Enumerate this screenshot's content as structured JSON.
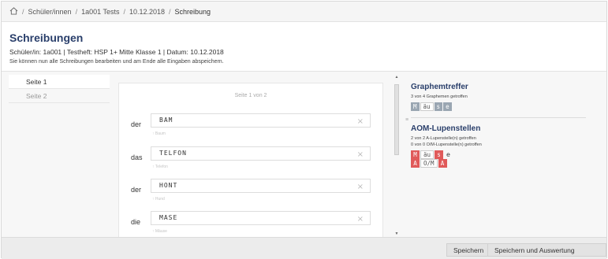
{
  "breadcrumb": {
    "items": [
      "Schüler/innen",
      "1a001 Tests",
      "10.12.2018",
      "Schreibung"
    ],
    "separator": "/"
  },
  "header": {
    "title": "Schreibungen",
    "subtitle": "Schüler/in: 1a001 | Testheft: HSP 1+ Mitte Klasse 1 | Datum: 10.12.2018",
    "hint": "Sie können nun alle Schreibungen bearbeiten und am Ende alle Eingaben abspeichern."
  },
  "sidebar": {
    "items": [
      {
        "label": "Seite 1",
        "active": true
      },
      {
        "label": "Seite 2",
        "active": false
      }
    ]
  },
  "editor": {
    "page_indicator": "Seite 1 von 2",
    "clear_symbol": "×",
    "words": [
      {
        "article": "der",
        "value": "BAM",
        "hint": "↑ Baum"
      },
      {
        "article": "das",
        "value": "TELFON",
        "hint": "↑ Telefon"
      },
      {
        "article": "der",
        "value": "HONT",
        "hint": "↑ Hund"
      },
      {
        "article": "die",
        "value": "MASE",
        "hint": "↑ Mäuse"
      }
    ]
  },
  "scroll": {
    "up": "▲",
    "down": "▼"
  },
  "results": {
    "graphem": {
      "title": "Graphemtreffer",
      "desc": "3 von 4 Graphemen getroffen",
      "tiles": [
        "M",
        "äu",
        "s",
        "e"
      ]
    },
    "aom": {
      "title": "AOM-Lupenstellen",
      "desc1": "2 von 2 A-Lupenstelle(n) getroffen",
      "desc2": "0 von 0 O/M-Lupenstelle(n) getroffen",
      "row1": [
        "M",
        "äu",
        "s",
        "e"
      ],
      "row2": [
        "A",
        "O/M",
        "A"
      ]
    }
  },
  "footer": {
    "save_label": "Speichern",
    "save_eval_label": "Speichern und Auswertung ansehen",
    "save_eval_arrow": "›"
  },
  "colors": {
    "title": "#2a3f6b",
    "tile_gray": "#9aa6b2",
    "tile_red": "#e05a5a"
  }
}
